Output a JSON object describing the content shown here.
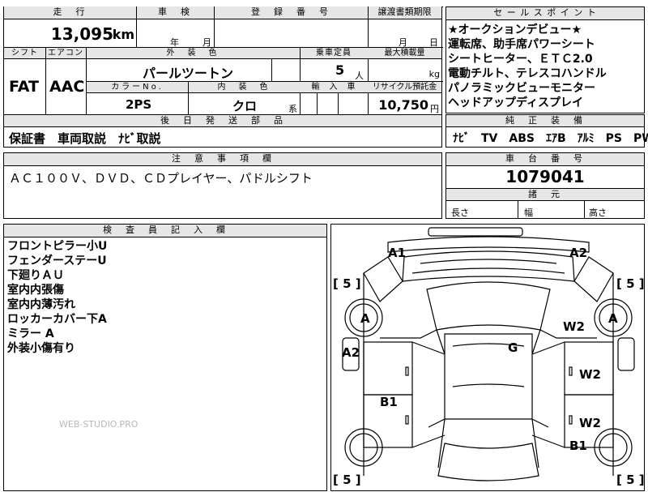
{
  "top": {
    "mileage_label": "走　行",
    "mileage_value": "13,095",
    "mileage_unit": "km",
    "inspection_label": "車　検",
    "inspection_year": "年",
    "inspection_month": "月",
    "registration_label": "登　録　番　号",
    "transfer_label": "譲渡書類期限",
    "transfer_month": "月",
    "transfer_day": "日",
    "shift_label": "シフト",
    "shift_value": "FAT",
    "ac_label": "エアコン",
    "ac_value": "AAC",
    "exterior_label": "外　装　色",
    "exterior_value": "パールツートン",
    "capacity_label": "乗車定員",
    "capacity_value": "5",
    "capacity_unit": "人",
    "load_label": "最大積載量",
    "load_unit": "kg",
    "color_no_label": "カラーNo.",
    "color_no_value": "2PS",
    "interior_label": "内　装　色",
    "interior_value": "クロ",
    "interior_suffix": "系",
    "import_label": "輸　入　車",
    "recycle_label": "リサイクル預託金",
    "recycle_value": "10,750",
    "recycle_unit": "円"
  },
  "later_parts": {
    "label": "後　日　発　送　部　品",
    "value": "保証書　車両取説　ﾅﾋﾞ取説"
  },
  "sales_points": {
    "label": "セ ー ル ス ポ イ ン ト",
    "lines": [
      "★オークションデビュー★",
      "運転席、助手席パワーシート",
      "シートヒーター、ＥＴＣ2.0",
      "電動チルト、テレスコハンドル",
      "パノラミックビューモニター",
      "ヘッドアップディスプレイ"
    ]
  },
  "equipment": {
    "label": "純　正　装　備",
    "value": "ﾅﾋﾞ　TV　ABS　ｴｱB　ｱﾙﾐ　PS　PW"
  },
  "notes": {
    "label": "注　意　事　項　欄",
    "value": "ＡＣ１００Ｖ、ＤＶＤ、ＣＤプレイヤー、パドルシフト"
  },
  "chassis": {
    "label": "車　台　番　号",
    "value": "1079041",
    "dims_label": "諸　元",
    "length_label": "長さ",
    "width_label": "幅",
    "height_label": "高さ"
  },
  "inspector": {
    "label": "検　査　員　記　入　欄",
    "lines": [
      "フロントピラー小U",
      "フェンダーステーU",
      "下廻りＡＵ",
      "室内内張傷",
      "室内内薄汚れ",
      "ロッカーカバー下A",
      "ミラー A",
      "外装小傷有り"
    ]
  },
  "watermark": "WEB-STUDIO.PRO",
  "diagram": {
    "marks": {
      "a1": "A1",
      "a2_top": "A2",
      "a2_left": "A2",
      "tire_fl": "A",
      "tire_fr": "A",
      "w2_1": "W2",
      "w2_2": "W2",
      "w2_3": "W2",
      "g": "G",
      "b1_left": "B1",
      "b1_right": "B1"
    },
    "tread": {
      "fl": "[ 5 ]",
      "fr": "[ 5 ]",
      "rl": "[ 5 ]",
      "rr": "[ 5 ]"
    }
  }
}
